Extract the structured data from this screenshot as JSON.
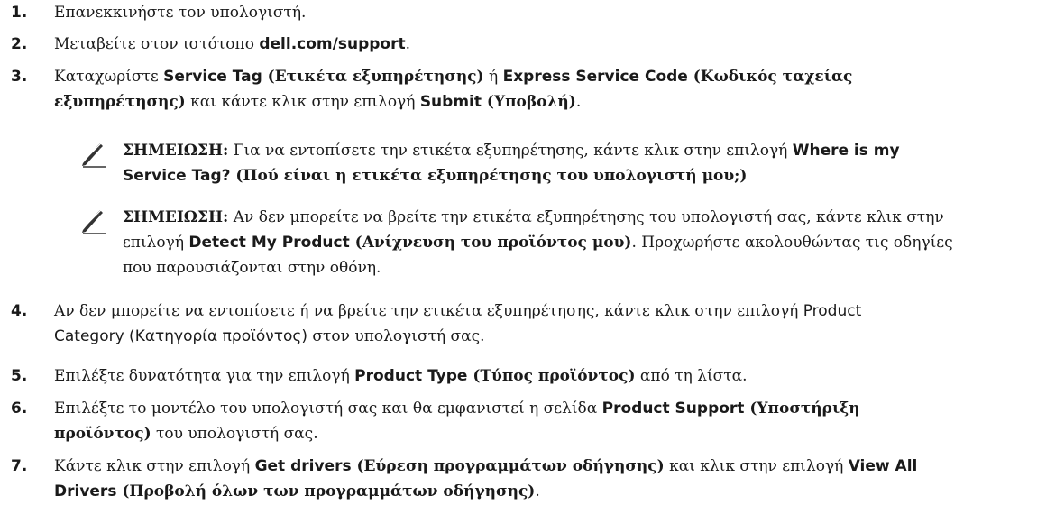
{
  "steps": [
    {
      "num": "1.",
      "text": "Επανεκκινήστε τον υπολογιστή."
    },
    {
      "num": "2.",
      "pre": "Μεταβείτε στον ιστότοπο ",
      "link": "dell.com/support",
      "post": "."
    },
    {
      "num": "3.",
      "a": "Καταχωρίστε ",
      "b1": "Service Tag",
      "b2": " (Ετικέτα εξυπηρέτησης)",
      "c": " ή ",
      "d1": "Express Service Code",
      "d2": " (Κωδικός ταχείας",
      "d3": "εξυπηρέτησης)",
      "e": " και κάντε κλικ στην επιλογή ",
      "f1": "Submit",
      "f2": " (Υποβολή)",
      "g": "."
    },
    {
      "num": "4.",
      "l1": "Αν δεν μπορείτε να εντοπίσετε ή να βρείτε την ετικέτα εξυπηρέτησης, κάντε κλικ στην επιλογή ",
      "l1b": "Product",
      "l2a": "Category (Κατηγορία προϊόντος)",
      "l2b": " στον υπολογιστή σας."
    },
    {
      "num": "5.",
      "a": "Επιλέξτε δυνατότητα για την επιλογή ",
      "b1": "Product Type",
      "b2": " (Τύπος προϊόντος)",
      "c": " από τη λίστα."
    },
    {
      "num": "6.",
      "a": "Επιλέξτε το μοντέλο του υπολογιστή σας και θα εμφανιστεί η σελίδα ",
      "b1": "Product Support",
      "b2": " (Υποστήριξη",
      "b3": "προϊόντος)",
      "c": " του υπολογιστή σας."
    },
    {
      "num": "7.",
      "a": "Κάντε κλικ στην επιλογή ",
      "b1": "Get drivers",
      "b2": " (Εύρεση προγραμμάτων οδήγησης)",
      "c": " και κλικ στην επιλογή ",
      "d1": "View All",
      "d2": "Drivers",
      "d3": " (Προβολή όλων των προγραμμάτων οδήγησης)",
      "e": "."
    }
  ],
  "notes": [
    {
      "label": "ΣΗΜΕΙΩΣΗ:",
      "a": " Για να εντοπίσετε την ετικέτα εξυπηρέτησης, κάντε κλικ στην επιλογή ",
      "b1": "Where is my",
      "b2": "Service Tag?",
      "b3": " (Πού είναι η ετικέτα εξυπηρέτησης του υπολογιστή μου;)"
    },
    {
      "label": "ΣΗΜΕΙΩΣΗ:",
      "a": " Αν δεν μπορείτε να βρείτε την ετικέτα εξυπηρέτησης του υπολογιστή σας, κάντε κλικ στην",
      "b": "επιλογή ",
      "c1": "Detect My Product",
      "c2": " (Ανίχνευση του προϊόντος μου)",
      "d": ". Προχωρήστε ακολουθώντας τις οδηγίες",
      "e": "που παρουσιάζονται στην οθόνη."
    }
  ],
  "icons": {
    "note": "pencil-note-icon"
  }
}
